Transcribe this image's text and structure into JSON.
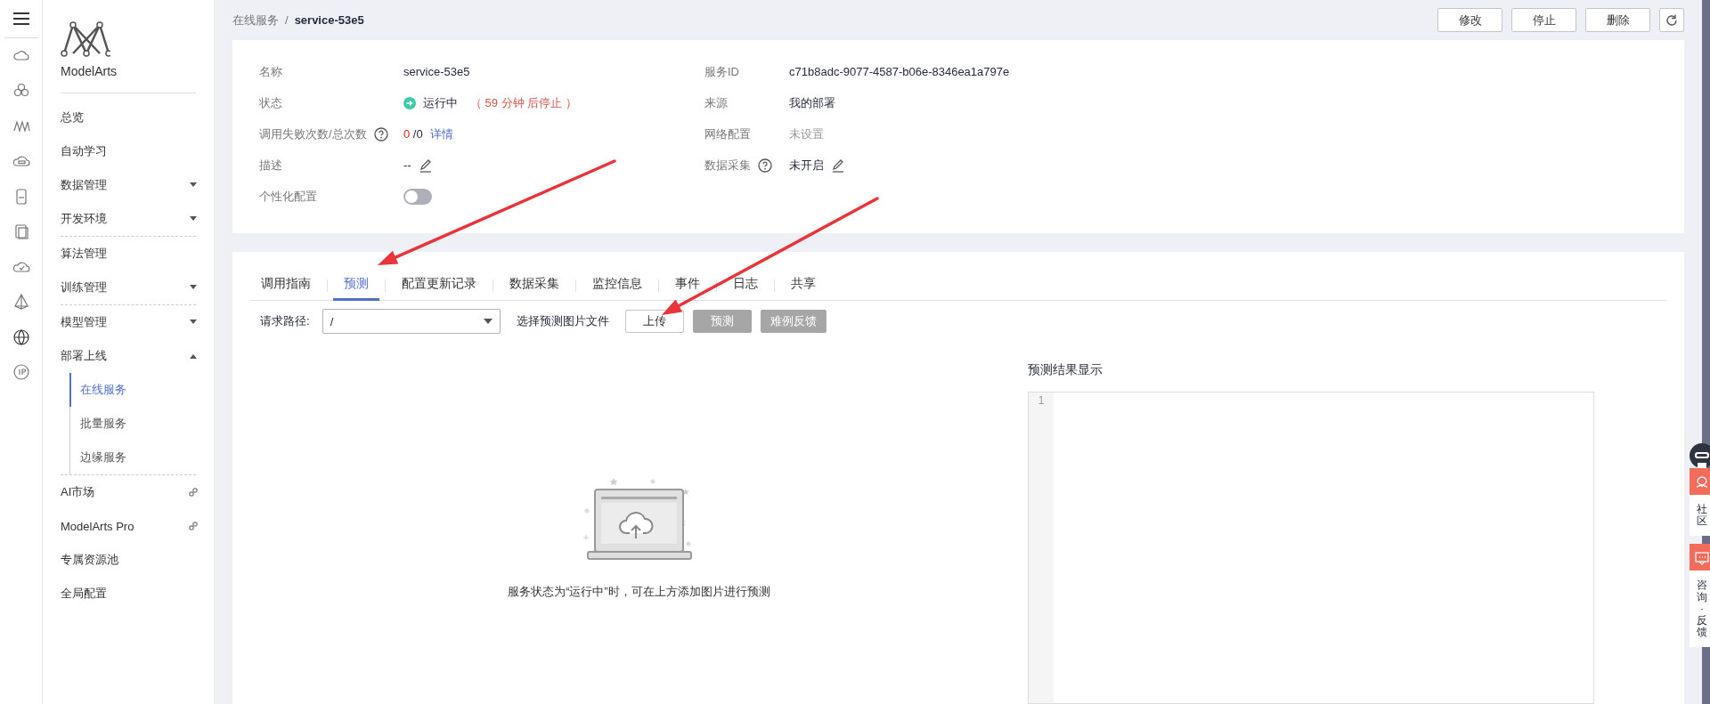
{
  "sidebar": {
    "brand": "ModelArts",
    "items": [
      {
        "label": "总览",
        "kind": "plain",
        "selected": false,
        "divider_after": false
      },
      {
        "label": "自动学习",
        "kind": "plain",
        "selected": false,
        "divider_after": false
      },
      {
        "label": "数据管理",
        "kind": "group",
        "expanded": false,
        "selected": false,
        "divider_after": false
      },
      {
        "label": "开发环境",
        "kind": "group",
        "expanded": false,
        "selected": false,
        "divider_after": true
      },
      {
        "label": "算法管理",
        "kind": "plain",
        "selected": false,
        "divider_after": false
      },
      {
        "label": "训练管理",
        "kind": "group",
        "expanded": false,
        "selected": false,
        "divider_after": true
      },
      {
        "label": "模型管理",
        "kind": "group",
        "expanded": false,
        "selected": false,
        "divider_after": false
      },
      {
        "label": "部署上线",
        "kind": "group",
        "expanded": true,
        "selected": false,
        "divider_after": true,
        "children": [
          {
            "label": "在线服务",
            "selected": true
          },
          {
            "label": "批量服务",
            "selected": false
          },
          {
            "label": "边缘服务",
            "selected": false
          }
        ]
      },
      {
        "label": "AI市场",
        "kind": "link",
        "selected": false,
        "divider_after": false
      },
      {
        "label": "ModelArts Pro",
        "kind": "link",
        "selected": false,
        "divider_after": false
      },
      {
        "label": "专属资源池",
        "kind": "plain",
        "selected": false,
        "divider_after": false
      },
      {
        "label": "全局配置",
        "kind": "plain",
        "selected": false,
        "divider_after": false
      }
    ]
  },
  "breadcrumb": {
    "separator": "/",
    "items": [
      {
        "label": "在线服务"
      },
      {
        "label": "service-53e5"
      }
    ]
  },
  "actions": [
    "修改",
    "停止",
    "删除"
  ],
  "details": {
    "left": [
      {
        "label": "名称",
        "kind": "text",
        "value": "service-53e5"
      },
      {
        "label": "状态",
        "kind": "status",
        "value": "运行中",
        "note": "（ 59 分钟 后停止 ）"
      },
      {
        "label": "调用失败次数/总次数",
        "kind": "count",
        "help": true,
        "failed": "0",
        "total": "/0",
        "link": "详情"
      },
      {
        "label": "描述",
        "kind": "editable",
        "value": "--"
      },
      {
        "label": "个性化配置",
        "kind": "toggle",
        "on": false
      }
    ],
    "right": [
      {
        "label": "服务ID",
        "kind": "text",
        "value": "c71b8adc-9077-4587-b06e-8346ea1a797e"
      },
      {
        "label": "来源",
        "kind": "text",
        "value": "我的部署"
      },
      {
        "label": "网络配置",
        "kind": "muted",
        "value": "未设置"
      },
      {
        "label": "数据采集",
        "kind": "editable",
        "help": true,
        "value": "未开启"
      }
    ]
  },
  "tabs": [
    {
      "label": "调用指南",
      "selected": false
    },
    {
      "label": "预测",
      "selected": true
    },
    {
      "label": "配置更新记录",
      "selected": false
    },
    {
      "label": "数据采集",
      "selected": false
    },
    {
      "label": "监控信息",
      "selected": false
    },
    {
      "label": "事件",
      "selected": false
    },
    {
      "label": "日志",
      "selected": false
    },
    {
      "label": "共享",
      "selected": false
    }
  ],
  "toolbar": {
    "path_label": "请求路径:",
    "path_value": "/",
    "file_label": "选择预测图片文件",
    "buttons": [
      {
        "label": "上传",
        "disabled": false
      },
      {
        "label": "预测",
        "disabled": true
      },
      {
        "label": "难例反馈",
        "disabled": true
      }
    ]
  },
  "empty_hint": "服务状态为“运行中”时，可在上方添加图片进行预测",
  "result": {
    "title": "预测结果显示",
    "line_numbers": [
      "1"
    ]
  },
  "float_widget": [
    {
      "label": "社区"
    },
    {
      "label": "咨询·反馈"
    }
  ],
  "annotations": [
    {
      "kind": "arrow"
    },
    {
      "kind": "arrow"
    }
  ]
}
